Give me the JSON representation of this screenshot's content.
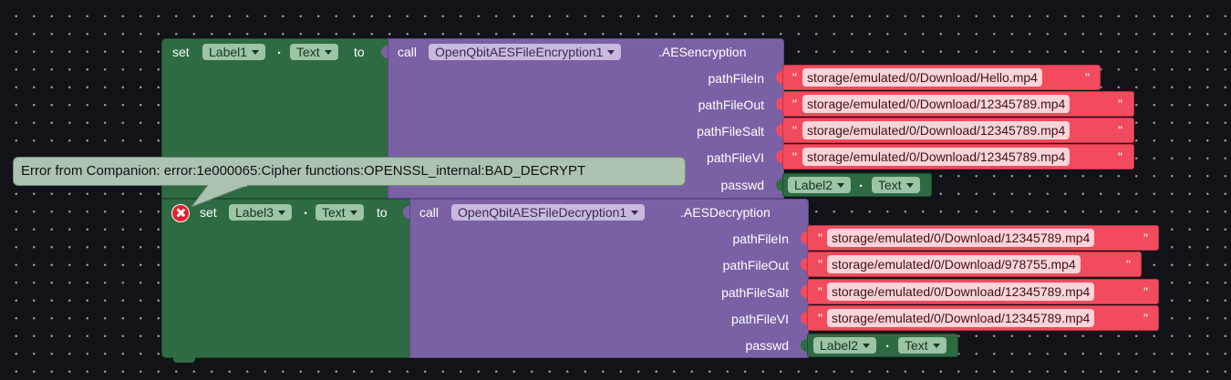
{
  "block1": {
    "set": "set",
    "label_component": "Label1",
    "property": "Text",
    "to": "to",
    "call": "call",
    "component": "OpenQbitAESFileEncryption1",
    "method": ".AESencryption",
    "params": [
      {
        "name": "pathFileIn",
        "value": "storage/emulated/0/Download/Hello.mp4"
      },
      {
        "name": "pathFileOut",
        "value": "storage/emulated/0/Download/12345789.mp4"
      },
      {
        "name": "pathFileSalt",
        "value": "storage/emulated/0/Download/12345789.mp4"
      },
      {
        "name": "pathFileVI",
        "value": "storage/emulated/0/Download/12345789.mp4"
      }
    ],
    "passwd": {
      "name": "passwd",
      "component": "Label2",
      "property": "Text"
    }
  },
  "block2": {
    "set": "set",
    "label_component": "Label3",
    "property": "Text",
    "to": "to",
    "call": "call",
    "component": "OpenQbitAESFileDecryption1",
    "method": ".AESDecryption",
    "params": [
      {
        "name": "pathFileIn",
        "value": "storage/emulated/0/Download/12345789.mp4"
      },
      {
        "name": "pathFileOut",
        "value": "storage/emulated/0/Download/978755.mp4"
      },
      {
        "name": "pathFileSalt",
        "value": "storage/emulated/0/Download/12345789.mp4"
      },
      {
        "name": "pathFileVI",
        "value": "storage/emulated/0/Download/12345789.mp4"
      }
    ],
    "passwd": {
      "name": "passwd",
      "component": "Label2",
      "property": "Text"
    }
  },
  "error_tooltip": "Error from Companion: error:1e000065:Cipher functions:OPENSSL_internal:BAD_DECRYPT",
  "quote_char": "\"",
  "dot": ".",
  "colors": {
    "set_block": "#2e6b43",
    "call_block": "#7a61a6",
    "text_block": "#f24b5e",
    "tooltip": "#adc3b2",
    "error_icon": "#e3212f",
    "workspace": "#111318"
  }
}
